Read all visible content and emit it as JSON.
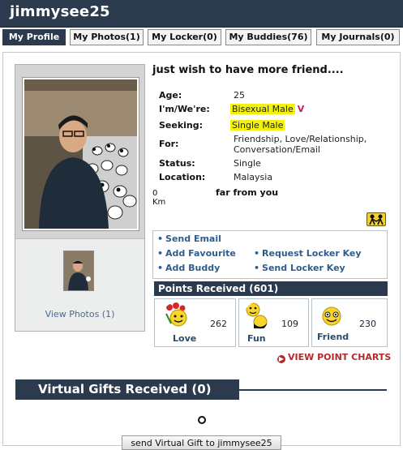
{
  "header": {
    "title": "jimmysee25"
  },
  "tabs": [
    {
      "label": "My Profile"
    },
    {
      "label": "My Photos(1)"
    },
    {
      "label": "My Locker(0)"
    },
    {
      "label": "My Buddies(76)"
    },
    {
      "label": "My Journals(0)"
    }
  ],
  "profile": {
    "headline": "just wish to have more friend....",
    "fields": {
      "age_label": "Age:",
      "age": "25",
      "iam_label": "I'm/We're:",
      "iam": "Bisexual Male",
      "iam_badge": "V",
      "seeking_label": "Seeking:",
      "seeking": "Single Male",
      "for_label": "For:",
      "for_line1": "Friendship, Love/Relationship,",
      "for_line2": "Conversation/Email",
      "status_label": "Status:",
      "status": "Single",
      "location_label": "Location:",
      "location": "Malaysia"
    },
    "distance": {
      "value": "0 Km",
      "text": "far from you"
    },
    "view_photos": "View Photos (1)"
  },
  "actions": {
    "send_email": "Send Email",
    "add_favourite": "Add Favourite",
    "request_locker_key": "Request Locker Key",
    "add_buddy": "Add Buddy",
    "send_locker_key": "Send Locker Key"
  },
  "points": {
    "header": "Points Received (601)",
    "items": [
      {
        "label": "Love",
        "value": "262"
      },
      {
        "label": "Fun",
        "value": "109"
      },
      {
        "label": "Friend",
        "value": "230"
      }
    ],
    "view_charts": "VIEW POINT CHARTS"
  },
  "gifts": {
    "header": "Virtual Gifts Received (0)",
    "send_button": "send Virtual Gift to jimmysee25"
  },
  "colors": {
    "header_bg": "#2b3a4c",
    "link": "#2e5d8a",
    "highlight": "#f4f20a",
    "chart_link": "#b22a2a"
  }
}
